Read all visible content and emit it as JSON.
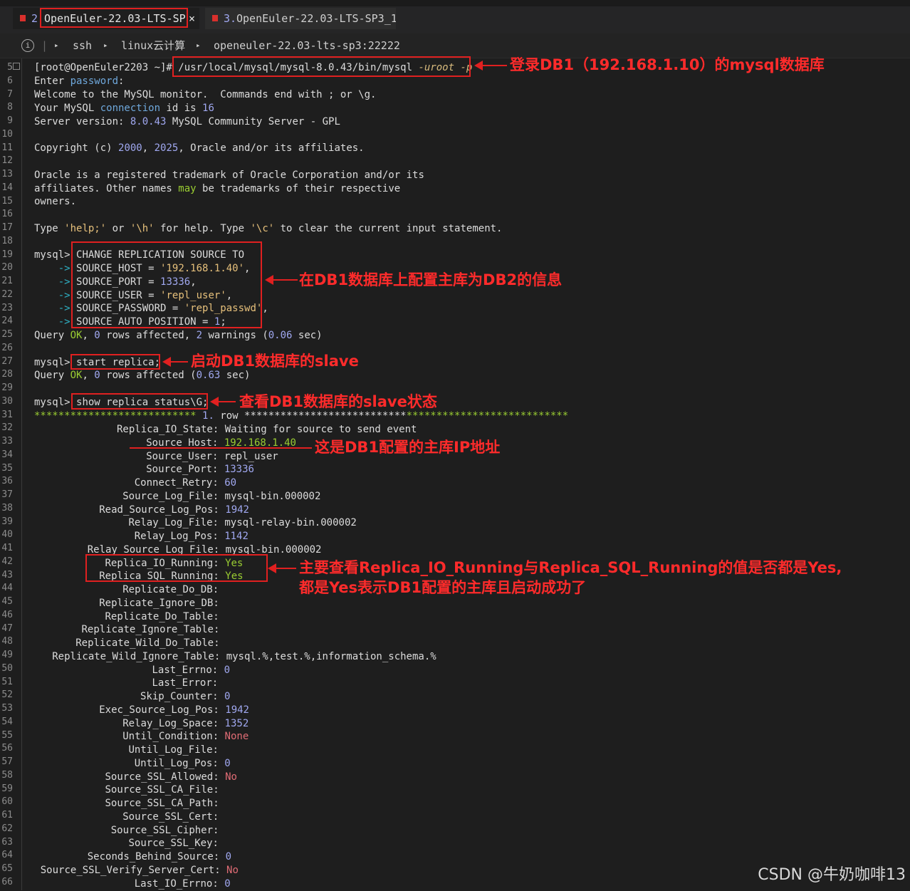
{
  "tabs": [
    {
      "num": "2",
      "title": "OpenEuler-22.03-LTS-SP",
      "close": "×"
    },
    {
      "num": "3.",
      "title": "OpenEuler-22.03-LTS-SP3_1"
    }
  ],
  "breadcrumb": {
    "info": "i",
    "sep": "|",
    "items": [
      "ssh",
      "linux云计算",
      "openeuler-22.03-lts-sp3:22222"
    ],
    "arrow": "▸"
  },
  "gutter_first": "5",
  "lines": {
    "l5a": "[root@OpenEuler2203 ~]# ",
    "l5b": "/usr/local/mysql/mysql-8.0.43/bin/mysql ",
    "l5c": "-uroot -p",
    "l6a": "Enter ",
    "l6b": "password",
    ":": ":",
    "l7": "Welcome to the MySQL monitor.  Commands end with ; or \\g.",
    "l8a": "Your MySQL ",
    "l8b": "connection",
    "l8c": " id is ",
    "l8d": "16",
    "l9a": "Server version: ",
    "l9b": "8.0.43",
    "l9c": " MySQL Community Server - GPL",
    "l11a": "Copyright (c) ",
    "l11b": "2000",
    "l11c": ", ",
    "l11d": "2025",
    "l11e": ", Oracle and/or its affiliates.",
    "l13": "Oracle is a registered trademark of Oracle Corporation and/or its",
    "l14a": "affiliates. Other names ",
    "l14b": "may",
    "l14c": " be trademarks of their respective",
    "l15": "owners.",
    "l17a": "Type ",
    "l17b": "'help;'",
    "l17c": " or ",
    "l17d": "'\\h'",
    "l17e": " for help. Type ",
    "l17f": "'\\c'",
    "l17g": " to clear the current input statement.",
    "prompt": "mysql> ",
    "cont": "    -> ",
    "l19": "CHANGE REPLICATION SOURCE TO",
    "l20a": "SOURCE_HOST = ",
    "l20b": "'192.168.1.40'",
    "l20c": ",",
    "l21a": "SOURCE_PORT = ",
    "l21b": "13336",
    "l21c": ",",
    "l22a": "SOURCE_USER = ",
    "l22b": "'repl_user'",
    "l22c": ",",
    "l23a": "SOURCE_PASSWORD = ",
    "l23b": "'repl_passwd'",
    "l23c": ",",
    "l24a": "SOURCE_AUTO_POSITION = ",
    "l24b": "1",
    "l24c": ";",
    "q_a": "Query ",
    "ok": "OK",
    "q_b": ", ",
    "zero": "0",
    "q_c": " rows affected, ",
    "two": "2",
    "q_d": " warnings (",
    "t1": "0.06",
    "q_e": " sec)",
    "l27": "start replica;",
    "q2_c": " rows affected (",
    "t2": "0.63",
    "l30": "show replica status\\G;",
    "l31a": "*************************** ",
    "l31b": "1.",
    "l31c": " row ***************************"
  },
  "status": [
    {
      "k": "Replica_IO_State",
      "v": "Waiting for source to send event",
      "c": ""
    },
    {
      "k": "Source_Host",
      "v": "192.168.1.40",
      "c": "grn"
    },
    {
      "k": "Source_User",
      "v": "repl_user",
      "c": ""
    },
    {
      "k": "Source_Port",
      "v": "13336",
      "c": "num"
    },
    {
      "k": "Connect_Retry",
      "v": "60",
      "c": "num"
    },
    {
      "k": "Source_Log_File",
      "v": "mysql-bin.000002",
      "c": ""
    },
    {
      "k": "Read_Source_Log_Pos",
      "v": "1942",
      "c": "num"
    },
    {
      "k": "Relay_Log_File",
      "v": "mysql-relay-bin.000002",
      "c": ""
    },
    {
      "k": "Relay_Log_Pos",
      "v": "1142",
      "c": "num"
    },
    {
      "k": "Relay_Source_Log_File",
      "v": "mysql-bin.000002",
      "c": ""
    },
    {
      "k": "Replica_IO_Running",
      "v": "Yes",
      "c": "grn"
    },
    {
      "k": "Replica_SQL_Running",
      "v": "Yes",
      "c": "grn"
    },
    {
      "k": "Replicate_Do_DB",
      "v": "",
      "c": ""
    },
    {
      "k": "Replicate_Ignore_DB",
      "v": "",
      "c": ""
    },
    {
      "k": "Replicate_Do_Table",
      "v": "",
      "c": ""
    },
    {
      "k": "Replicate_Ignore_Table",
      "v": "",
      "c": ""
    },
    {
      "k": "Replicate_Wild_Do_Table",
      "v": "",
      "c": ""
    },
    {
      "k": "Replicate_Wild_Ignore_Table",
      "v": "mysql.%,test.%,information_schema.%",
      "c": ""
    },
    {
      "k": "Last_Errno",
      "v": "0",
      "c": "num"
    },
    {
      "k": "Last_Error",
      "v": "",
      "c": ""
    },
    {
      "k": "Skip_Counter",
      "v": "0",
      "c": "num"
    },
    {
      "k": "Exec_Source_Log_Pos",
      "v": "1942",
      "c": "num"
    },
    {
      "k": "Relay_Log_Space",
      "v": "1352",
      "c": "num"
    },
    {
      "k": "Until_Condition",
      "v": "None",
      "c": "red"
    },
    {
      "k": "Until_Log_File",
      "v": "",
      "c": ""
    },
    {
      "k": "Until_Log_Pos",
      "v": "0",
      "c": "num"
    },
    {
      "k": "Source_SSL_Allowed",
      "v": "No",
      "c": "red"
    },
    {
      "k": "Source_SSL_CA_File",
      "v": "",
      "c": ""
    },
    {
      "k": "Source_SSL_CA_Path",
      "v": "",
      "c": ""
    },
    {
      "k": "Source_SSL_Cert",
      "v": "",
      "c": ""
    },
    {
      "k": "Source_SSL_Cipher",
      "v": "",
      "c": ""
    },
    {
      "k": "Source_SSL_Key",
      "v": "",
      "c": ""
    },
    {
      "k": "Seconds_Behind_Source",
      "v": "0",
      "c": "num"
    },
    {
      "k": "Source_SSL_Verify_Server_Cert",
      "v": "No",
      "c": "red"
    },
    {
      "k": "Last_IO_Errno",
      "v": "0",
      "c": "num"
    }
  ],
  "annotations": {
    "a1": "登录DB1（192.168.1.10）的mysql数据库",
    "a2": "在DB1数据库上配置主库为DB2的信息",
    "a3": "启动DB1数据库的slave",
    "a4": "查看DB1数据库的slave状态",
    "a5": "这是DB1配置的主库IP地址",
    "a6": "主要查看Replica_IO_Running与Replica_SQL_Running的值是否都是Yes,",
    "a7": "都是Yes表示DB1配置的主库且启动成功了"
  },
  "watermark": "CSDN @牛奶咖啡13",
  "colors": {
    "annotation": "#ff2b2b",
    "ok": "#9acd32",
    "prompt": "#2fb3c7",
    "number": "#a0a8f0",
    "string": "#e6c07b"
  }
}
